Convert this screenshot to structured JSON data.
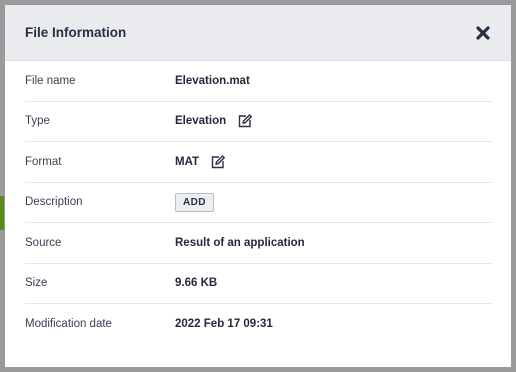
{
  "dialog": {
    "title": "File Information",
    "close_icon": "close-icon"
  },
  "rows": [
    {
      "label": "File name",
      "value": "Elevation.mat"
    },
    {
      "label": "Type",
      "value": "Elevation",
      "icon": "edit-icon"
    },
    {
      "label": "Format",
      "value": "MAT",
      "icon": "edit-icon"
    },
    {
      "label": "Description",
      "button": "ADD"
    },
    {
      "label": "Source",
      "value": "Result of an application"
    },
    {
      "label": "Size",
      "value": "9.66 KB"
    },
    {
      "label": "Modification date",
      "value": "2022 Feb 17 09:31"
    }
  ],
  "colors": {
    "header_bg": "#e9ebee",
    "title_text": "#2a2f45",
    "backdrop": "#9b9b9b",
    "accent_strip": "#5a8a1e"
  }
}
